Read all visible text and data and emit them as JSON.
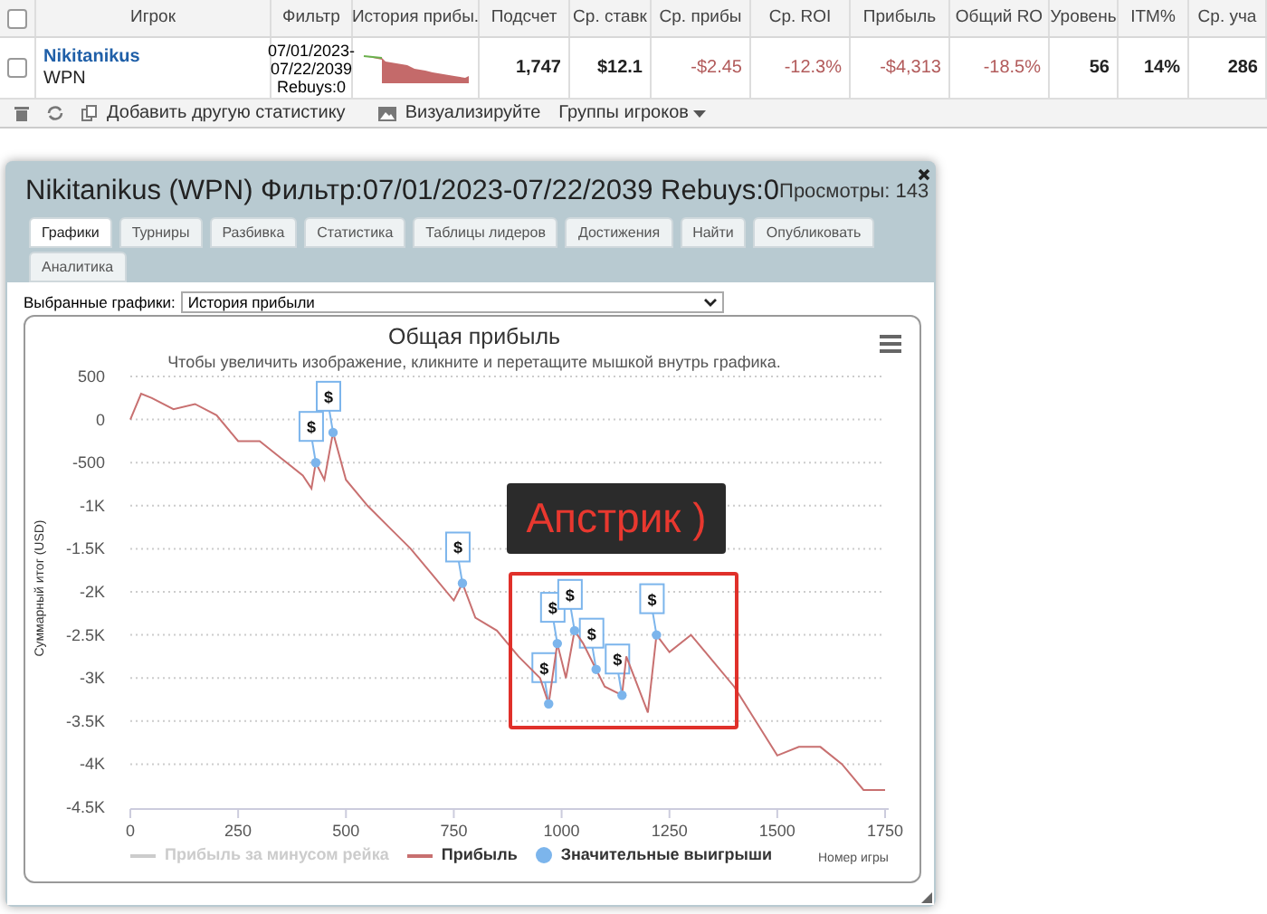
{
  "table": {
    "columns": [
      {
        "kind": "checkbox",
        "checked": false
      },
      {
        "kind": "text",
        "label": "Игрок"
      },
      {
        "kind": "text",
        "label": "Фильтр"
      },
      {
        "kind": "text",
        "label": "История прибы."
      },
      {
        "kind": "text",
        "label": "Подсчет"
      },
      {
        "kind": "text",
        "label": "Ср. ставк"
      },
      {
        "kind": "text",
        "label": "Ср. прибы"
      },
      {
        "kind": "text",
        "label": "Ср. ROI"
      },
      {
        "kind": "text",
        "label": "Прибыль"
      },
      {
        "kind": "text",
        "label": "Общий RO"
      },
      {
        "kind": "text",
        "label": "Уровень"
      },
      {
        "kind": "text",
        "label": "ITM%"
      },
      {
        "kind": "text",
        "label": "Ср. уча"
      }
    ],
    "rows": [
      {
        "cells": [
          {
            "kind": "checkbox",
            "checked": false
          },
          {
            "kind": "player",
            "text": "Nikitanikus",
            "network": "WPN"
          },
          {
            "kind": "lines",
            "lines": [
              "07/01/2023-",
              "07/22/2039",
              "Rebuys:0"
            ]
          },
          {
            "kind": "sparkline"
          },
          {
            "kind": "number",
            "text": "1,747",
            "negative": false
          },
          {
            "kind": "number",
            "text": "$12.1",
            "negative": false
          },
          {
            "kind": "number",
            "text": "-$2.45",
            "negative": true
          },
          {
            "kind": "number",
            "text": "-12.3%",
            "negative": true
          },
          {
            "kind": "number",
            "text": "-$4,313",
            "negative": true
          },
          {
            "kind": "number",
            "text": "-18.5%",
            "negative": true
          },
          {
            "kind": "number",
            "text": "56",
            "negative": false
          },
          {
            "kind": "number",
            "text": "14%",
            "negative": false
          },
          {
            "kind": "number",
            "text": "286",
            "negative": false
          }
        ]
      }
    ]
  },
  "toolbar": {
    "add_label": "Добавить другую статистику",
    "visualize_label": "Визуализируйте",
    "groups_label": "Группы игроков"
  },
  "dialog": {
    "title": "Nikitanikus (WPN) Фильтр:07/01/2023-07/22/2039 Rebuys:0",
    "views": "Просмотры: 143",
    "tabs": [
      {
        "label": "Графики",
        "selected": true
      },
      {
        "label": "Турниры",
        "selected": false
      },
      {
        "label": "Разбивка",
        "selected": false
      },
      {
        "label": "Статистика",
        "selected": false
      },
      {
        "label": "Таблицы лидеров",
        "selected": false
      },
      {
        "label": "Достижения",
        "selected": false
      },
      {
        "label": "Найти",
        "selected": false
      },
      {
        "label": "Опубликовать",
        "selected": false
      },
      {
        "label": "Аналитика",
        "selected": false
      }
    ],
    "chart_select": {
      "label": "Выбранные графики:",
      "value": "История прибыли"
    },
    "chart": {
      "subtitle": "Чтобы увеличить изображение, кликните и перетащите мышкой внутрь графика.",
      "hidden_legend": {
        "label": "Прибыль за минусом рейка",
        "disabled": true
      },
      "flags": [
        "$",
        "$",
        "$",
        "$",
        "$",
        "$",
        "$",
        "$",
        "$"
      ],
      "overlay_label": "Апстрик )",
      "chart_data": {
        "type": "line",
        "title": "Общая прибыль",
        "xlabel": "Номер игры",
        "ylabel": "Суммарный итог (USD)",
        "grid": true,
        "legend": true,
        "x": [
          0,
          25,
          50,
          100,
          150,
          200,
          250,
          300,
          350,
          400,
          420,
          430,
          450,
          470,
          500,
          550,
          600,
          650,
          700,
          750,
          770,
          800,
          850,
          900,
          950,
          970,
          980,
          990,
          1010,
          1030,
          1050,
          1080,
          1100,
          1140,
          1150,
          1200,
          1220,
          1250,
          1300,
          1350,
          1400,
          1450,
          1500,
          1550,
          1600,
          1650,
          1700,
          1750
        ],
        "series": [
          {
            "name": "Прибыль",
            "color": "#c87070",
            "values": [
              0,
              300,
              250,
              120,
              180,
              50,
              -250,
              -250,
              -450,
              -650,
              -800,
              -500,
              -700,
              -150,
              -700,
              -1000,
              -1250,
              -1500,
              -1800,
              -2100,
              -1900,
              -2300,
              -2450,
              -2750,
              -3000,
              -3300,
              -2950,
              -2600,
              -3000,
              -2450,
              -2600,
              -2900,
              -3100,
              -3200,
              -2750,
              -3400,
              -2500,
              -2700,
              -2500,
              -2800,
              -3100,
              -3500,
              -3900,
              -3800,
              -3800,
              -4000,
              -4300,
              -4300
            ]
          },
          {
            "name": "Значительные выигрыши",
            "color": "#7cb5ec",
            "marker": "circle",
            "values": [
              null,
              null,
              null,
              null,
              null,
              null,
              null,
              null,
              null,
              null,
              null,
              -500,
              null,
              -150,
              null,
              null,
              null,
              null,
              null,
              null,
              -1900,
              null,
              null,
              null,
              null,
              -3300,
              null,
              -2600,
              null,
              -2450,
              null,
              -2900,
              null,
              -3200,
              null,
              null,
              -2500,
              null,
              null,
              null,
              null,
              null,
              null,
              null,
              null,
              null,
              null,
              null
            ]
          }
        ],
        "xlim": [
          0,
          1750
        ],
        "ylim": [
          -4500,
          500
        ],
        "xticks": [
          0,
          250,
          500,
          750,
          1000,
          1250,
          1500,
          1750
        ],
        "yticks": [
          {
            "value": 500,
            "label": "500"
          },
          {
            "value": 0,
            "label": "0"
          },
          {
            "value": -500,
            "label": "-500"
          },
          {
            "value": -1000,
            "label": "-1K"
          },
          {
            "value": -1500,
            "label": "-1.5K"
          },
          {
            "value": -2000,
            "label": "-2K"
          },
          {
            "value": -2500,
            "label": "-2.5K"
          },
          {
            "value": -3000,
            "label": "-3K"
          },
          {
            "value": -3500,
            "label": "-3.5K"
          },
          {
            "value": -4000,
            "label": "-4K"
          },
          {
            "value": -4500,
            "label": "-4.5K"
          }
        ]
      }
    }
  }
}
